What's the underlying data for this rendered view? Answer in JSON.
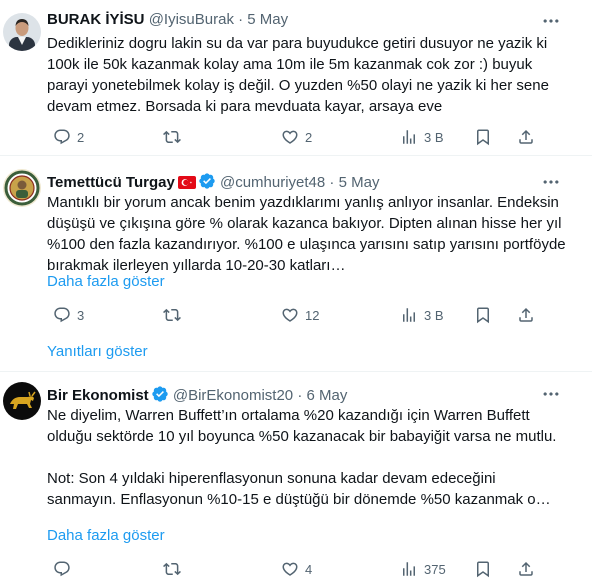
{
  "tweets": [
    {
      "name": "BURAK İYİSU",
      "handle": "@IyisuBurak",
      "sep": "·",
      "date": "5 May",
      "text": "Dedikleriniz dogru lakin su da var para buyudukce getiri dusuyor ne yazik ki 100k ile 50k kazanmak kolay ama 10m ile 5m kazanmak cok zor :) buyuk parayi yonetebilmek kolay iş değil. O yuzden %50 olayi ne yazik ki her sene devam etmez. Borsada ki para mevduata kayar, arsaya eve",
      "replies": "2",
      "retweets": "",
      "likes": "2",
      "views": "3 B"
    },
    {
      "name": "Temettücü Turgay",
      "flag": "🇹🇷",
      "handle": "@cumhuriyet48",
      "sep": "·",
      "date": "5 May",
      "text": "Mantıklı bir yorum ancak benim yazdıklarımı yanlış anlıyor insanlar. Endeksin düşüşü ve çıkışına göre % olarak kazanca bakıyor. Dipten alınan hisse her yıl %100 den fazla kazandırıyor. %100 e ulaşınca yarısını satıp yarısını portföyde bırakmak ilerleyen yıllarda 10-20-30 katları…",
      "show_more": "Daha fazla göster",
      "replies": "3",
      "retweets": "",
      "likes": "12",
      "views": "3 B"
    },
    {
      "name": "Bir Ekonomist",
      "handle": "@BirEkonomist20",
      "sep": "·",
      "date": "6 May",
      "text": "Ne diyelim, Warren Buffett’ın ortalama %20 kazandığı için Warren Buffett olduğu sektörde 10 yıl boyunca %50 kazanacak bir babayiğit varsa ne mutlu.\n\nNot: Son 4 yıldaki hiperenflasyonun sonuna kadar devam edeceğini sanmayın. Enflasyonun %10-15 e düştüğü bir dönemde %50 kazanmak o…",
      "show_more": "Daha fazla göster",
      "replies": "",
      "retweets": "",
      "likes": "4",
      "views": "375"
    }
  ],
  "show_replies": "Yanıtları göster",
  "colors": {
    "accent": "#1d9bf0",
    "muted": "#536471",
    "text": "#0f1419",
    "verified": "#1d9bf0"
  },
  "icons": [
    "reply-icon",
    "retweet-icon",
    "like-icon",
    "views-icon",
    "bookmark-icon",
    "share-icon",
    "more-icon",
    "verified-badge-icon"
  ]
}
